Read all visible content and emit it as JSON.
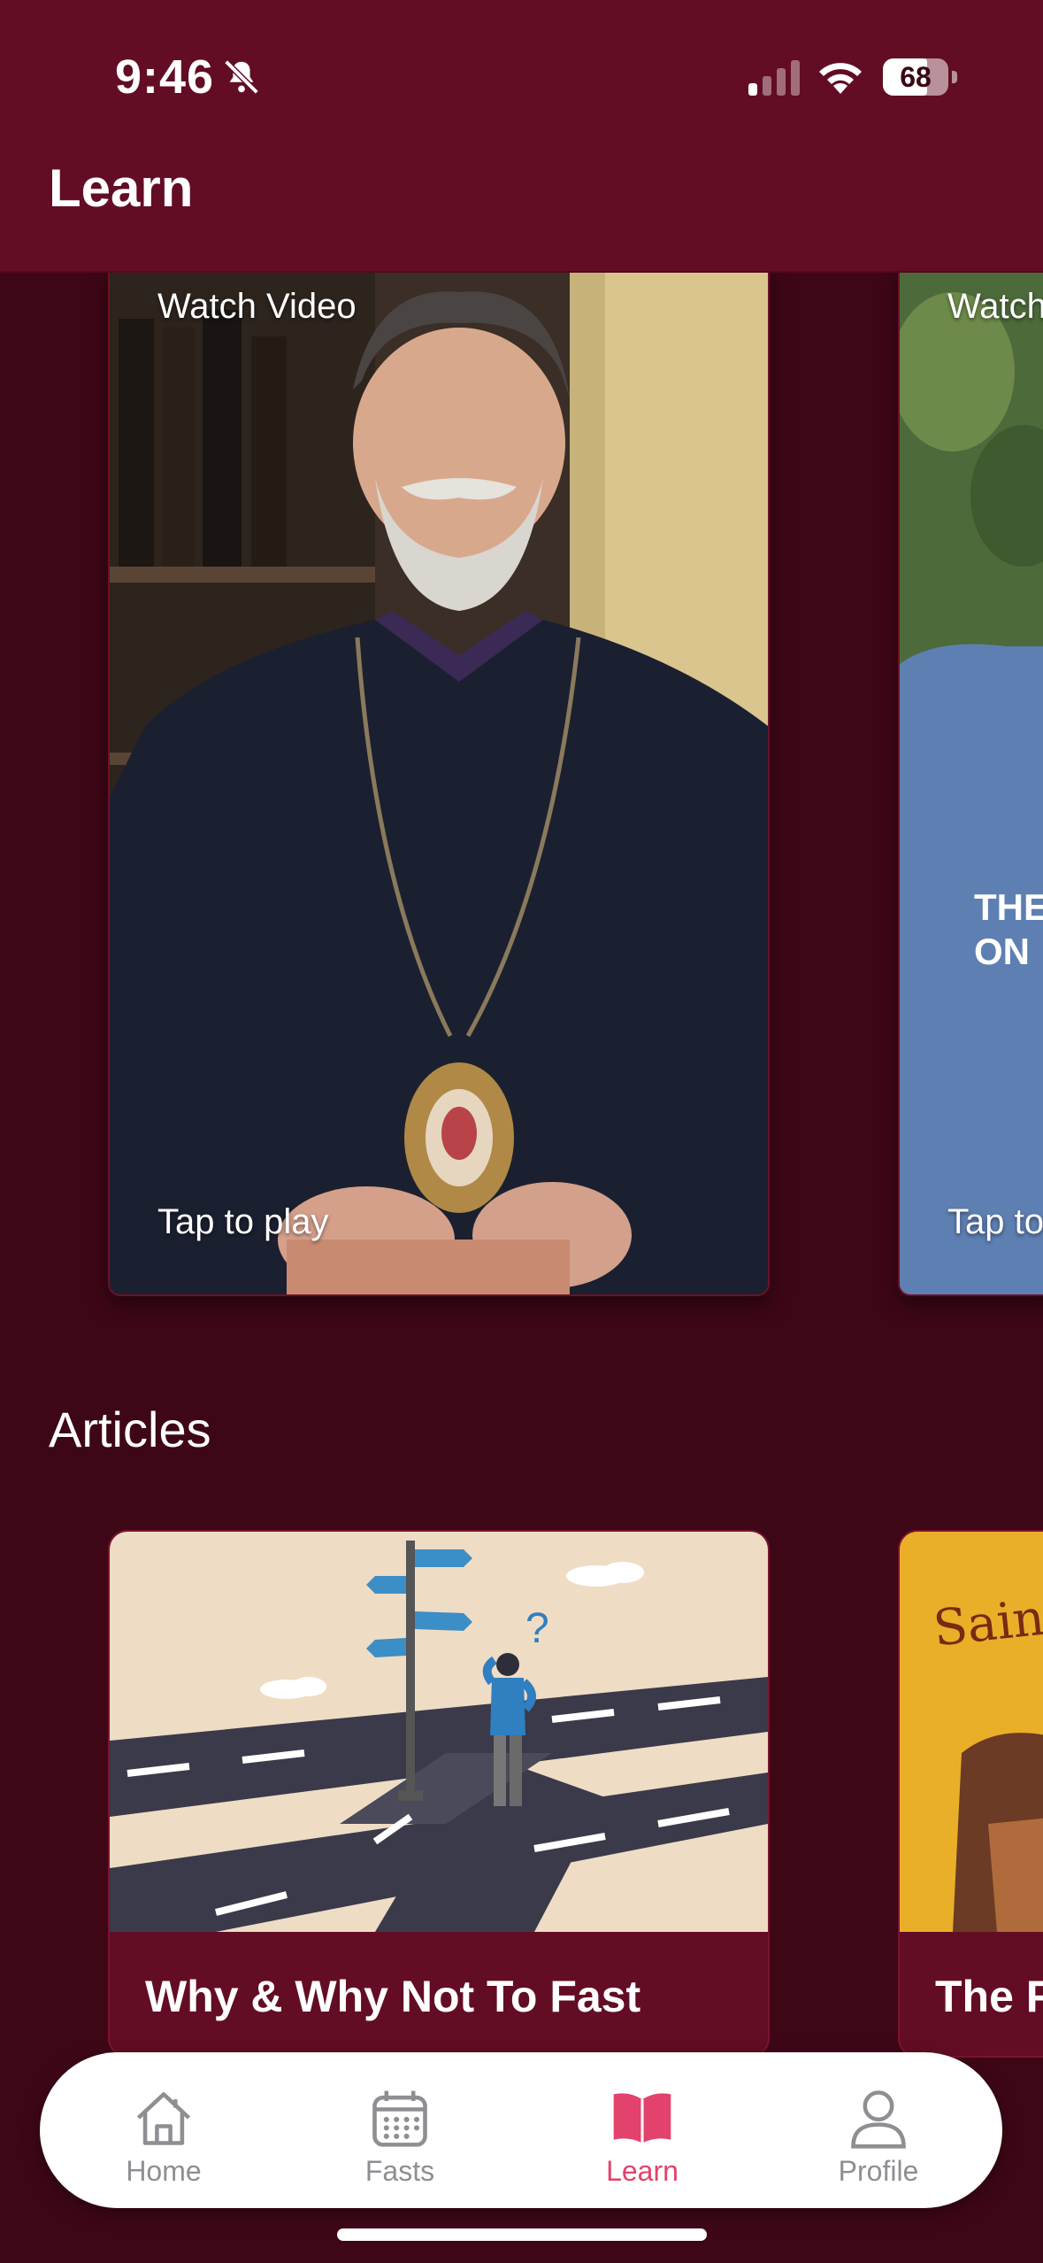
{
  "status_bar": {
    "time": "9:46",
    "battery": "68",
    "battery_level": 0.68,
    "icons": [
      "bell-slash-icon",
      "signal-icon",
      "wifi-icon",
      "battery-icon"
    ]
  },
  "header": {
    "title": "Learn"
  },
  "colors": {
    "header_bg": "#630d24",
    "page_bg": "#3e0716",
    "accent": "#e2426c",
    "tab_inactive": "#8e8e93"
  },
  "videos": [
    {
      "watch_label": "Watch Video",
      "tap_label": "Tap to play"
    },
    {
      "watch_label": "Watch",
      "tap_label": "Tap to",
      "overlay_text": "THE ON"
    }
  ],
  "articles_section": {
    "title": "Articles",
    "items": [
      {
        "title": "Why & Why Not To Fast"
      },
      {
        "title": "The F",
        "image_text": "Saint"
      }
    ]
  },
  "tabbar": {
    "tabs": [
      {
        "label": "Home",
        "icon": "home-icon",
        "active": false
      },
      {
        "label": "Fasts",
        "icon": "calendar-icon",
        "active": false
      },
      {
        "label": "Learn",
        "icon": "book-icon",
        "active": true
      },
      {
        "label": "Profile",
        "icon": "person-icon",
        "active": false
      }
    ]
  }
}
